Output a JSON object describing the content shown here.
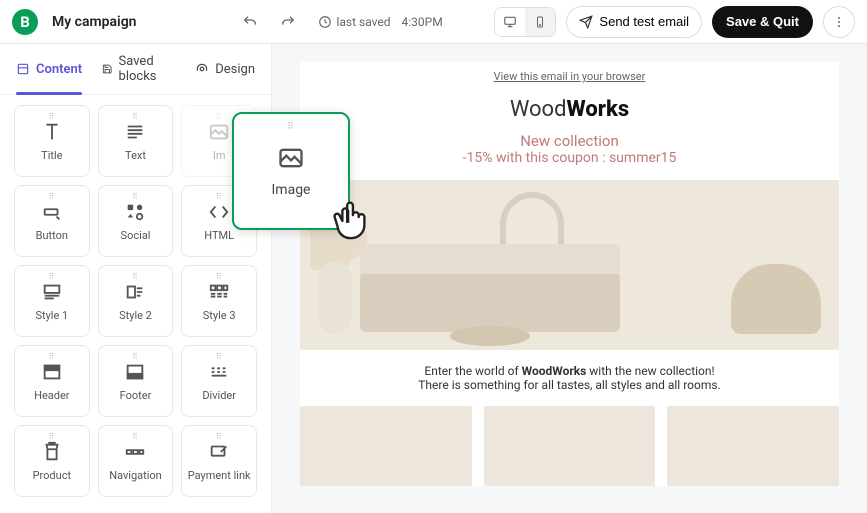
{
  "topbar": {
    "brand_letter": "B",
    "campaign_name": "My campaign",
    "last_saved_prefix": "last saved",
    "last_saved_time": "4:30PM",
    "send_test_label": "Send test email",
    "save_quit_label": "Save & Quit"
  },
  "tabs": {
    "content": "Content",
    "saved_blocks": "Saved blocks",
    "design": "Design"
  },
  "blocks": {
    "title": "Title",
    "text": "Text",
    "image_ghost": "Im",
    "button": "Button",
    "social": "Social",
    "html": "HTML",
    "style1": "Style 1",
    "style2": "Style 2",
    "style3": "Style 3",
    "header": "Header",
    "footer": "Footer",
    "divider": "Divider",
    "product": "Product",
    "navigation": "Navigation",
    "payment_link": "Payment link"
  },
  "drag": {
    "label": "Image"
  },
  "email": {
    "view_in_browser": "View this email in your browser",
    "logo_thin": "Wood",
    "logo_bold": "Works",
    "promo_line1": "New collection",
    "promo_line2": "-15% with this coupon : summer15",
    "copy_line1_pre": "Enter the world of ",
    "copy_line1_brand": "WoodWorks",
    "copy_line1_post": " with the new collection!",
    "copy_line2": "There is something for all tastes, all styles and all rooms."
  }
}
